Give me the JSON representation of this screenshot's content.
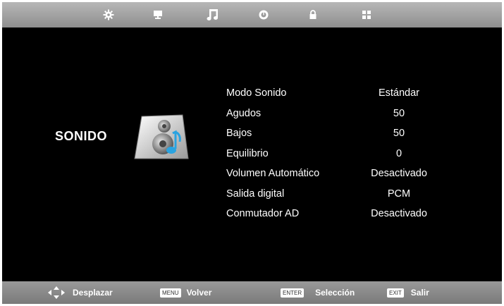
{
  "top_menu": {
    "tabs": [
      {
        "icon": "gear-icon",
        "label": ""
      },
      {
        "icon": "monitor-icon",
        "label": ""
      },
      {
        "icon": "music-note-icon",
        "label": ""
      },
      {
        "icon": "clock-icon",
        "label": ""
      },
      {
        "icon": "lock-icon",
        "label": ""
      },
      {
        "icon": "grid-icon",
        "label": ""
      }
    ],
    "active_tab": "music-note-icon"
  },
  "section": {
    "title": "SONIDO",
    "icon": "speaker-icon"
  },
  "settings": [
    {
      "label": "Modo Sonido",
      "value": "Estándar"
    },
    {
      "label": "Agudos",
      "value": "50"
    },
    {
      "label": "Bajos",
      "value": "50"
    },
    {
      "label": "Equilibrio",
      "value": "0"
    },
    {
      "label": "Volumen Automático",
      "value": "Desactivado"
    },
    {
      "label": "Salida digital",
      "value": "PCM"
    },
    {
      "label": "Conmutador AD",
      "value": "Desactivado"
    }
  ],
  "bottom_hints": {
    "navigate": {
      "icon": "arrows-icon",
      "label": "Desplazar"
    },
    "menu": {
      "key": "MENU",
      "label": "Volver"
    },
    "enter": {
      "key": "ENTER",
      "label": "Selección"
    },
    "exit": {
      "key": "EXIT",
      "label": "Salir"
    }
  },
  "colors": {
    "background": "#000000",
    "bar": "#a0a0a0",
    "text": "#ffffff",
    "accent": "#2aa3e0"
  }
}
